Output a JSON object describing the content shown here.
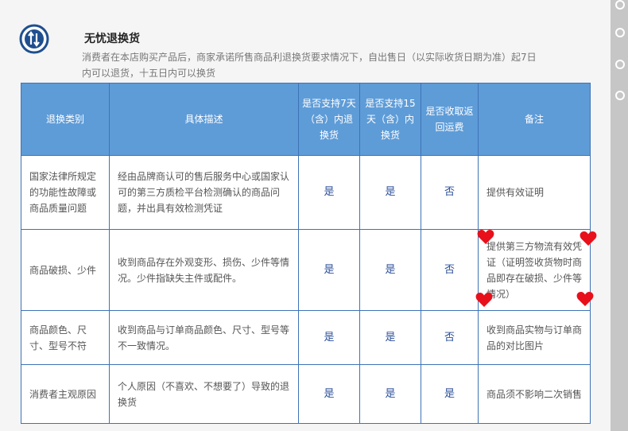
{
  "header": {
    "title": "无忧退换货",
    "description": "消费者在本店购买产品后，商家承诺所售商品利退换货要求情况下，自出售日（以实际收货日期为准）起7日内可以退货，十五日内可以换货"
  },
  "table": {
    "headers": [
      "退换类别",
      "具体描述",
      "是否支持7天（含）内退换货",
      "是否支持15天（含）内换货",
      "是否收取返回运费",
      "备注"
    ],
    "rows": [
      {
        "category": "国家法律所规定的功能性故障或商品质量问题",
        "description": "经由品牌商认可的售后服务中心或国家认可的第三方质检平台检测确认的商品问题，并出具有效检测凭证",
        "return7": "是",
        "exchange15": "是",
        "shipping": "否",
        "note": "提供有效证明"
      },
      {
        "category": "商品破损、少件",
        "description": "收到商品存在外观变形、损伤、少件等情况。少件指缺失主件或配件。",
        "return7": "是",
        "exchange15": "是",
        "shipping": "否",
        "note": "提供第三方物流有效凭证（证明签收货物时商品即存在破损、少件等情况）"
      },
      {
        "category": "商品颜色、尺寸、型号不符",
        "description": "收到商品与订单商品颜色、尺寸、型号等不一致情况。",
        "return7": "是",
        "exchange15": "是",
        "shipping": "否",
        "note": "收到商品实物与订单商品的对比图片"
      },
      {
        "category": "消费者主观原因",
        "description": "个人原因（不喜欢、不想要了）导致的退换货",
        "return7": "是",
        "exchange15": "是",
        "shipping": "是",
        "note": "商品须不影响二次销售"
      }
    ]
  },
  "colors": {
    "header_bg": "#5e9cd8",
    "border": "#3e73b6",
    "yes_no_text": "#2c4f99",
    "heart": "#e8101b",
    "sidebar": "#c6c6c6"
  },
  "icons": {
    "logo": "return-arrows-icon",
    "decorations": "heart-icon"
  }
}
